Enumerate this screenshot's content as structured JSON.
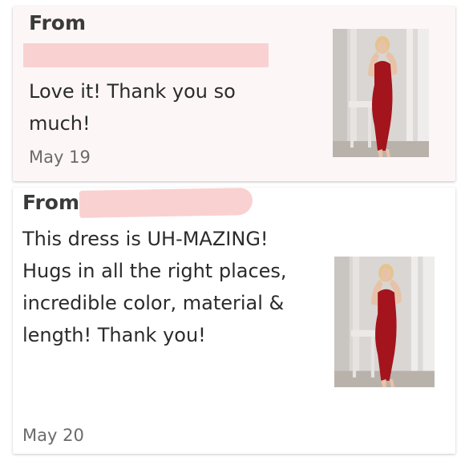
{
  "reviews": [
    {
      "from_label": "From",
      "text": "Love it! Thank you so much!",
      "date": "May 19",
      "photo_icon": "product-photo-red-dress"
    },
    {
      "from_label": "From",
      "text": "This dress is UH-MAZING! Hugs in all the right places, incredible color, material & length! Thank you!",
      "date": "May 20",
      "photo_icon": "product-photo-red-dress"
    }
  ],
  "colors": {
    "redaction": "#f9d1d1",
    "dress": "#a3141c",
    "card1_background": "#fdf6f7"
  }
}
